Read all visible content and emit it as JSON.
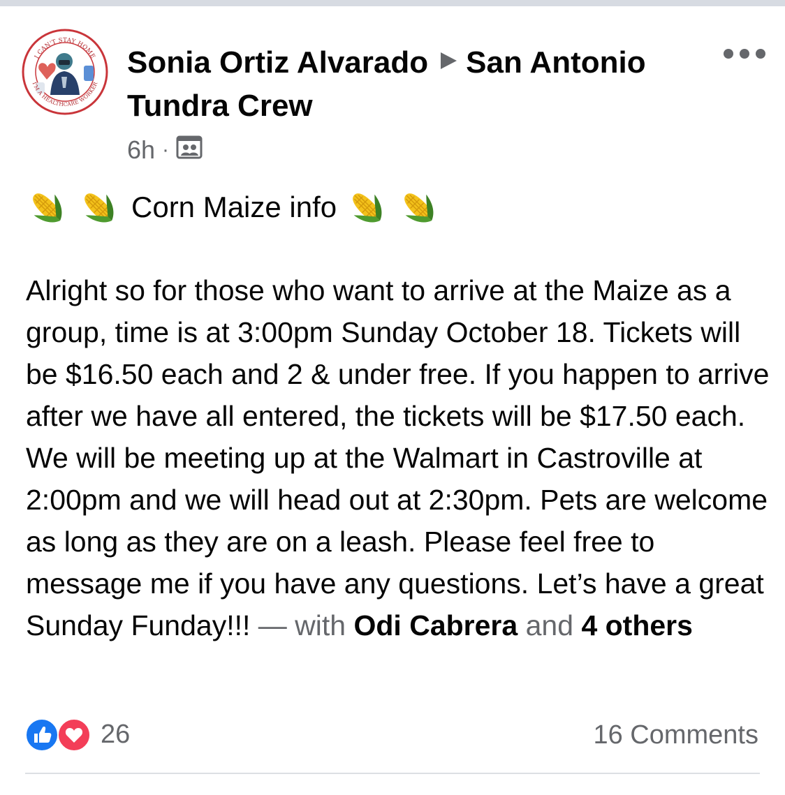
{
  "post": {
    "author": "Sonia Ortiz Alvarado",
    "group": "San Antonio Tundra Crew",
    "time": "6h",
    "separator": "·",
    "audience_icon": "group-audience-icon",
    "more_icon": "more-options-icon",
    "avatar_badge_text_top": "I CAN'T STAY HOME",
    "avatar_badge_text_bottom": "I'M A HEALTHCARE WORKER",
    "title": "Corn Maize info",
    "title_emoji": "corn-emoji",
    "body": "Alright so for those who want to arrive at the Maize as a group, time is at 3:00pm Sunday October 18. Tickets will be $16.50 each and 2 & under free. If you happen to arrive after we have all entered, the tickets will be $17.50 each. We will be meeting up at the Walmart in Castroville at 2:00pm and we will head out at 2:30pm. Pets are welcome as long as they are on a leash. Please feel free to message me if you have any questions. Let’s have a great Sunday Funday!!!",
    "tag_prefix": "— with",
    "tag_person": "Odi Cabrera",
    "tag_and": "and",
    "tag_others": "4 others"
  },
  "footer": {
    "reaction_count": "26",
    "reaction_types": [
      "like",
      "love"
    ],
    "comments_label": "16 Comments"
  },
  "colors": {
    "text_primary": "#050505",
    "text_secondary": "#65676b",
    "like_blue": "#1877f2",
    "love_red": "#f33e58",
    "divider": "#dcdfe3"
  }
}
